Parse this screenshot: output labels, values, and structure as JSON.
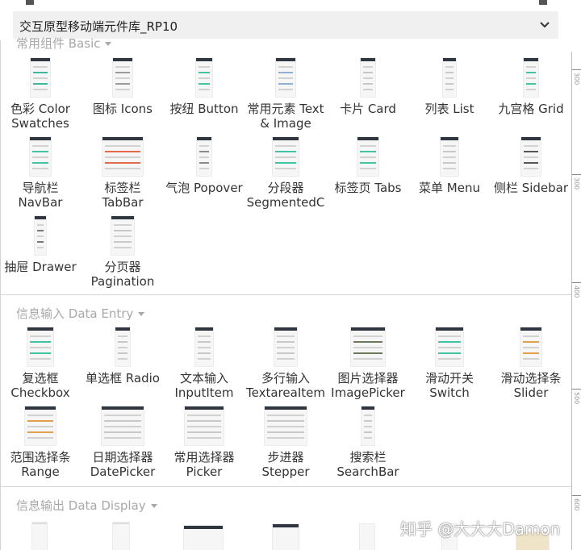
{
  "window": {
    "title": "交互原型移动端元件库_RP10"
  },
  "sections": [
    {
      "title": "常用组件 Basic",
      "items": [
        {
          "line1": "色彩 Color",
          "line2": "Swatches",
          "accent": "#3cb8a0"
        },
        {
          "line1": "图标 Icons",
          "line2": "",
          "accent": "#9a9a9a"
        },
        {
          "line1": "按纽 Button",
          "line2": "",
          "accent": "#42c3a3"
        },
        {
          "line1": "常用元素 Text",
          "line2": "& Image",
          "accent": "#8fb0d8"
        },
        {
          "line1": "卡片 Card",
          "line2": "",
          "accent": "#c8c8c8"
        },
        {
          "line1": "列表 List",
          "line2": "",
          "accent": "#c8c8c8"
        },
        {
          "line1": "九宫格 Grid",
          "line2": "",
          "accent": "#42c3a3"
        },
        {
          "line1": "导航栏",
          "line2": "NavBar",
          "accent": "#42c3a3"
        },
        {
          "line1": "标签栏",
          "line2": "TabBar",
          "accent": "#e36b4a"
        },
        {
          "line1": "气泡 Popover",
          "line2": "",
          "accent": "#8a8a8a"
        },
        {
          "line1": "分段器",
          "line2": "SegmentedC",
          "accent": "#42c3a3"
        },
        {
          "line1": "标签页 Tabs",
          "line2": "",
          "accent": "#42c3a3"
        },
        {
          "line1": "菜单 Menu",
          "line2": "",
          "accent": "#c8c8c8"
        },
        {
          "line1": "侧栏 Sidebar",
          "line2": "",
          "accent": "#555555"
        },
        {
          "line1": "抽屉 Drawer",
          "line2": "",
          "accent": "#777777"
        },
        {
          "line1": "分页器",
          "line2": "Pagination",
          "accent": "#c8c8c8"
        }
      ]
    },
    {
      "title": "信息输入 Data Entry",
      "items": [
        {
          "line1": "复选框",
          "line2": "Checkbox",
          "accent": "#42c3a3"
        },
        {
          "line1": "单选框 Radio",
          "line2": "",
          "accent": "#c8c8c8"
        },
        {
          "line1": "文本输入",
          "line2": "InputItem",
          "accent": "#c8c8c8"
        },
        {
          "line1": "多行输入",
          "line2": "TextareaItem",
          "accent": "#c8c8c8"
        },
        {
          "line1": "图片选择器",
          "line2": "ImagePicker",
          "accent": "#6b7a5a"
        },
        {
          "line1": "滑动开关",
          "line2": "Switch",
          "accent": "#42c3a3"
        },
        {
          "line1": "滑动选择条",
          "line2": "Slider",
          "accent": "#e3a04a"
        },
        {
          "line1": "范围选择条",
          "line2": "Range",
          "accent": "#e3a04a"
        },
        {
          "line1": "日期选择器",
          "line2": "DatePicker",
          "accent": "#c8c8c8"
        },
        {
          "line1": "常用选择器",
          "line2": "Picker",
          "accent": "#c8c8c8"
        },
        {
          "line1": "步进器",
          "line2": "Stepper",
          "accent": "#c8c8c8"
        },
        {
          "line1": "搜索栏",
          "line2": "SearchBar",
          "accent": "#c8c8c8"
        }
      ]
    },
    {
      "title": "信息输出 Data Display",
      "items": []
    }
  ],
  "ruler": {
    "labels": [
      "300",
      "300",
      "400",
      "500",
      "600"
    ]
  },
  "watermark": {
    "text": "知乎 @大大大Damon"
  }
}
